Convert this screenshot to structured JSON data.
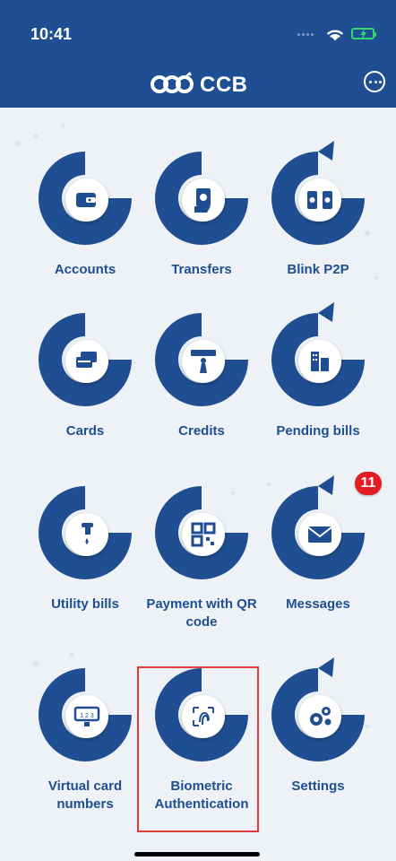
{
  "status": {
    "time": "10:41"
  },
  "brand": {
    "name": "CCB"
  },
  "badge": {
    "messages_count": "11"
  },
  "tiles": [
    {
      "key": "accounts",
      "label": "Accounts",
      "icon": "wallet-icon"
    },
    {
      "key": "transfers",
      "label": "Transfers",
      "icon": "money-transfer-icon"
    },
    {
      "key": "blink",
      "label": "Blink P2P",
      "icon": "phone-exchange-icon"
    },
    {
      "key": "cards",
      "label": "Cards",
      "icon": "cards-icon"
    },
    {
      "key": "credits",
      "label": "Credits",
      "icon": "credit-person-icon"
    },
    {
      "key": "pending",
      "label": "Pending bills",
      "icon": "building-icon"
    },
    {
      "key": "utility",
      "label": "Utility bills",
      "icon": "faucet-icon"
    },
    {
      "key": "qr",
      "label": "Payment with QR code",
      "icon": "qr-code-icon"
    },
    {
      "key": "messages",
      "label": "Messages",
      "icon": "envelope-icon"
    },
    {
      "key": "virtual",
      "label": "Virtual card numbers",
      "icon": "keypad-monitor-icon"
    },
    {
      "key": "biometric",
      "label": "Biometric Authentication",
      "icon": "fingerprint-icon"
    },
    {
      "key": "settings",
      "label": "Settings",
      "icon": "gears-icon"
    }
  ],
  "colors": {
    "primary": "#1f4f92",
    "badge": "#e31b23",
    "selection": "#e03a3a"
  }
}
